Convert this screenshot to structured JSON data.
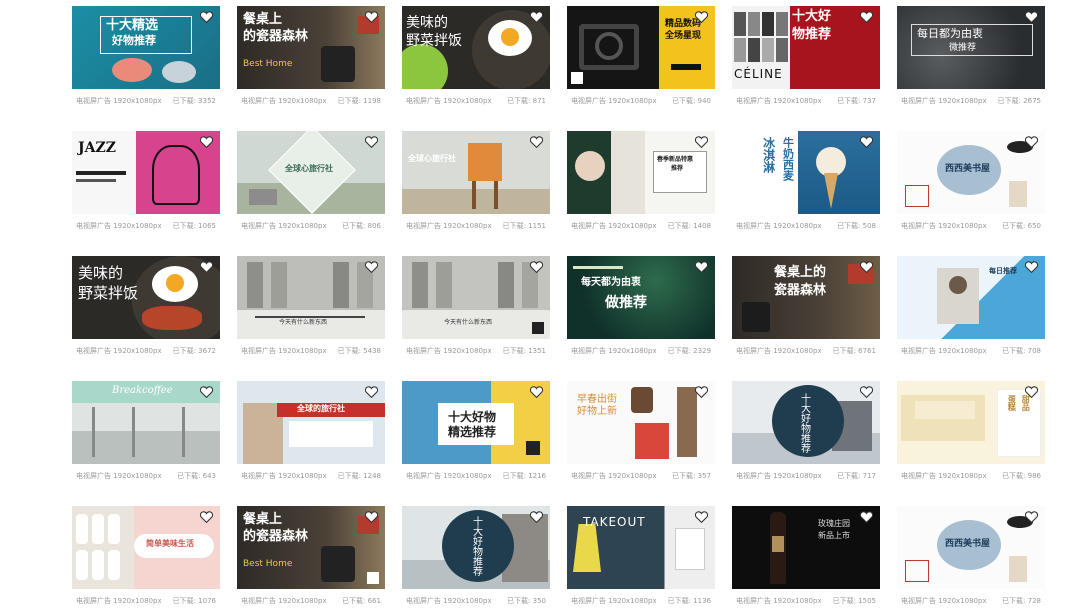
{
  "rows": [
    [
      {
        "title_lines": [
          "十大精选",
          "好物推荐"
        ],
        "size": "电视屏广告 1920x1080px",
        "downloads": "已下载: 3352"
      },
      {
        "title_lines": [
          "餐桌上",
          "的瓷器森林"
        ],
        "subtitle": "Best Home",
        "size": "电视屏广告 1920x1080px",
        "downloads": "已下载: 1198"
      },
      {
        "title_lines": [
          "美味的",
          "野菜拌饭"
        ],
        "size": "电视屏广告 1920x1080px",
        "downloads": "已下载: 871"
      },
      {
        "title_lines": [
          "精品数码",
          "全场星现"
        ],
        "size": "电视屏广告 1920x1080px",
        "downloads": "已下载: 940"
      },
      {
        "title_lines": [
          "十大好",
          "物推荐"
        ],
        "subtitle": "CÉLINE",
        "size": "电视屏广告 1920x1080px",
        "downloads": "已下载: 737"
      },
      {
        "title_lines": [
          "每日都为由衷",
          "微推荐"
        ],
        "size": "电视屏广告 1920x1080px",
        "downloads": "已下载: 2675"
      }
    ],
    [
      {
        "title_lines": [
          "JAZZ"
        ],
        "size": "电视屏广告 1920x1080px",
        "downloads": "已下载: 1065"
      },
      {
        "title_lines": [
          "全球心旅行社"
        ],
        "size": "电视屏广告 1920x1080px",
        "downloads": "已下载: 806"
      },
      {
        "title_lines": [
          "全球心旅行社"
        ],
        "size": "电视屏广告 1920x1080px",
        "downloads": "已下载: 1151"
      },
      {
        "title_lines": [
          "春季新品特惠",
          "推荐"
        ],
        "size": "电视屏广告 1920x1080px",
        "downloads": "已下载: 1408"
      },
      {
        "title_lines": [
          "冰淇淋",
          "牛奶西麦"
        ],
        "size": "电视屏广告 1920x1080px",
        "downloads": "已下载: 508"
      },
      {
        "title_lines": [
          "西西美书屋"
        ],
        "size": "电视屏广告 1920x1080px",
        "downloads": "已下载: 650"
      }
    ],
    [
      {
        "title_lines": [
          "美味的",
          "野菜拌饭"
        ],
        "size": "电视屏广告 1920x1080px",
        "downloads": "已下载: 3672"
      },
      {
        "title_lines": [
          "今天有什么新东西"
        ],
        "size": "电视屏广告 1920x1080px",
        "downloads": "已下载: 5438"
      },
      {
        "title_lines": [
          "今天有什么新东西"
        ],
        "size": "电视屏广告 1920x1080px",
        "downloads": "已下载: 1351"
      },
      {
        "title_lines": [
          "每天都为由衷",
          "做推荐"
        ],
        "size": "电视屏广告 1920x1080px",
        "downloads": "已下载: 2329"
      },
      {
        "title_lines": [
          "餐桌上的",
          "瓷器森林"
        ],
        "size": "电视屏广告 1920x1080px",
        "downloads": "已下载: 6761"
      },
      {
        "title_lines": [
          "每日推荐"
        ],
        "size": "电视屏广告 1920x1080px",
        "downloads": "已下载: 708"
      }
    ],
    [
      {
        "title_lines": [
          "Breakcoffee"
        ],
        "size": "电视屏广告 1920x1080px",
        "downloads": "已下载: 643"
      },
      {
        "title_lines": [
          "全球的旅行社"
        ],
        "size": "电视屏广告 1920x1080px",
        "downloads": "已下载: 1248"
      },
      {
        "title_lines": [
          "十大好物",
          "精选推荐"
        ],
        "size": "电视屏广告 1920x1080px",
        "downloads": "已下载: 1216"
      },
      {
        "title_lines": [
          "早春出街",
          "好物上新"
        ],
        "size": "电视屏广告 1920x1080px",
        "downloads": "已下载: 357"
      },
      {
        "title_lines": [
          "十大好物推荐"
        ],
        "size": "电视屏广告 1920x1080px",
        "downloads": "已下载: 717"
      },
      {
        "title_lines": [
          "蛋糕",
          "甜品"
        ],
        "size": "电视屏广告 1920x1080px",
        "downloads": "已下载: 986"
      }
    ],
    [
      {
        "title_lines": [
          "简单美味生活"
        ],
        "size": "电视屏广告 1920x1080px",
        "downloads": "已下载: 1076"
      },
      {
        "title_lines": [
          "餐桌上",
          "的瓷器森林"
        ],
        "subtitle": "Best Home",
        "size": "电视屏广告 1920x1080px",
        "downloads": "已下载: 661"
      },
      {
        "title_lines": [
          "十大好物推荐"
        ],
        "size": "电视屏广告 1920x1080px",
        "downloads": "已下载: 350"
      },
      {
        "title_lines": [
          "TAKEOUT"
        ],
        "size": "电视屏广告 1920x1080px",
        "downloads": "已下载: 1136"
      },
      {
        "title_lines": [
          "玫瑰庄园",
          "新品上市"
        ],
        "size": "电视屏广告 1920x1080px",
        "downloads": "已下载: 1505"
      },
      {
        "title_lines": [
          "西西美书屋"
        ],
        "size": "电视屏广告 1920x1080px",
        "downloads": "已下载: 728"
      }
    ]
  ],
  "colors": {
    "meta_text": "#9a9a9a",
    "heart": "#333333"
  }
}
